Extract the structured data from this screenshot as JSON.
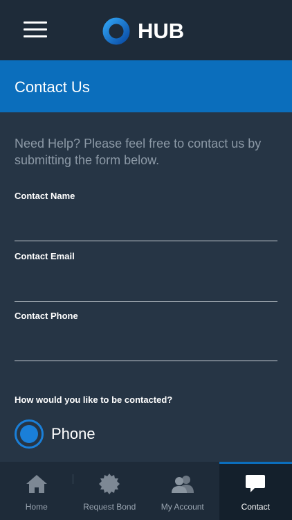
{
  "header": {
    "brand": "HUB",
    "menu_icon": "hamburger-menu-icon",
    "logo_icon": "hub-ring-logo",
    "brand_colors": {
      "ring_light": "#2fa0f0",
      "ring_dark": "#0b4fa8"
    }
  },
  "title_bar": {
    "title": "Contact Us",
    "color": "#0b6ebc"
  },
  "intro": "Need Help? Please feel free to contact us by submitting the form below.",
  "form": {
    "name_label": "Contact Name",
    "name_value": "",
    "email_label": "Contact Email",
    "email_value": "",
    "phone_label": "Contact Phone",
    "phone_value": "",
    "method_question": "How would you like to be contacted?",
    "method_selected": "Phone"
  },
  "tabs": [
    {
      "label": "Home",
      "icon": "home-icon",
      "active": false
    },
    {
      "label": "Request Bond",
      "icon": "seal-badge-icon",
      "active": false
    },
    {
      "label": "My Account",
      "icon": "users-icon",
      "active": false
    },
    {
      "label": "Contact",
      "icon": "chat-bubble-icon",
      "active": true
    }
  ],
  "colors": {
    "background": "#263545",
    "bars": "#1e2b39",
    "accent": "#0b6ebc",
    "radio": "#1a7fd8"
  }
}
